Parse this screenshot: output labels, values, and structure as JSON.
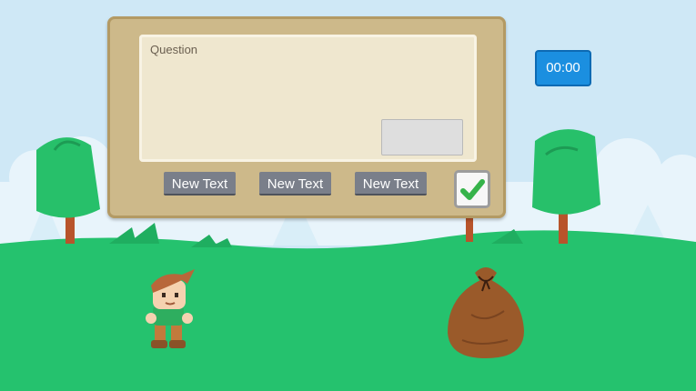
{
  "quiz": {
    "question_label": "Question",
    "options": [
      "New Text",
      "New Text",
      "New Text"
    ]
  },
  "timer": {
    "value": "00:00"
  },
  "icons": {
    "submit": "checkmark-icon"
  },
  "colors": {
    "sky": "#cfe8f6",
    "grass": "#25c26e",
    "panel": "#cdb98a",
    "timer": "#1b8fe0",
    "button": "#7a7f8a",
    "check": "#36b34a"
  }
}
